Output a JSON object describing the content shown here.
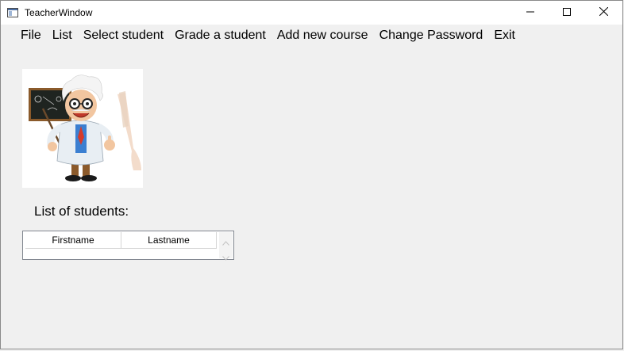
{
  "window": {
    "title": "TeacherWindow",
    "icons": {
      "app": "window-app-icon",
      "minimize": "minimize-icon",
      "maximize": "maximize-icon",
      "close": "close-icon"
    }
  },
  "menu": {
    "items": [
      {
        "label": "File"
      },
      {
        "label": "List"
      },
      {
        "label": "Select student"
      },
      {
        "label": "Grade a student"
      },
      {
        "label": "Add new course"
      },
      {
        "label": "Change Password"
      },
      {
        "label": "Exit"
      }
    ]
  },
  "main": {
    "image": {
      "icon": "teacher-cartoon-image"
    },
    "list_label": "List of students:",
    "grid": {
      "columns": [
        "Firstname",
        "Lastname"
      ],
      "rows": []
    }
  },
  "colors": {
    "background": "#f0f0f0",
    "titlebar": "#ffffff",
    "grid_border": "#828790"
  }
}
